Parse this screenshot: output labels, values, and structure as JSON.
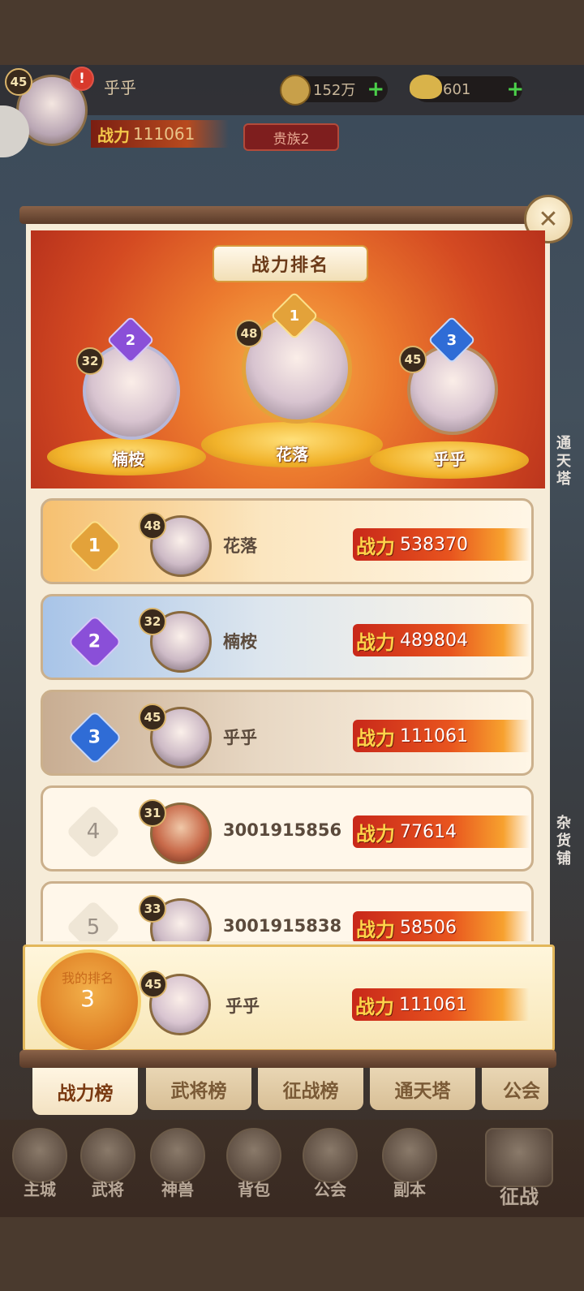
{
  "player": {
    "level": "45",
    "name": "乎乎",
    "power_label": "战力",
    "power": "111061",
    "noble": "贵族2",
    "alert": "!"
  },
  "resources": {
    "coins": "152万",
    "ingots": "601",
    "plus": "+"
  },
  "side": {
    "tongtianta": "通天塔",
    "zahuopu": "杂货铺"
  },
  "panel": {
    "title": "战力排名",
    "close": "✕"
  },
  "podium": [
    {
      "rank": "1",
      "level": "48",
      "name": "花落",
      "medal_color": "#e3a23a"
    },
    {
      "rank": "2",
      "level": "32",
      "name": "楠桉",
      "medal_color": "#8a4fd8"
    },
    {
      "rank": "3",
      "level": "45",
      "name": "乎乎",
      "medal_color": "#2f6cd6"
    }
  ],
  "rows": [
    {
      "rank": "1",
      "level": "48",
      "name": "花落",
      "power_label": "战力",
      "power": "538370"
    },
    {
      "rank": "2",
      "level": "32",
      "name": "楠桉",
      "power_label": "战力",
      "power": "489804"
    },
    {
      "rank": "3",
      "level": "45",
      "name": "乎乎",
      "power_label": "战力",
      "power": "111061"
    },
    {
      "rank": "4",
      "level": "31",
      "name": "3001915856",
      "power_label": "战力",
      "power": "77614"
    },
    {
      "rank": "5",
      "level": "33",
      "name": "3001915838",
      "power_label": "战力",
      "power": "58506"
    }
  ],
  "my_rank": {
    "label": "我的排名",
    "rank": "3",
    "level": "45",
    "name": "乎乎",
    "power_label": "战力",
    "power": "111061"
  },
  "tabs": [
    "战力榜",
    "武将榜",
    "征战榜",
    "通天塔",
    "公会"
  ],
  "nav": [
    "主城",
    "武将",
    "神兽",
    "背包",
    "公会",
    "副本",
    "征战"
  ],
  "colors": {
    "accent": "#e8541e",
    "gold": "#f1b22a",
    "panel": "#f6ecd8"
  }
}
